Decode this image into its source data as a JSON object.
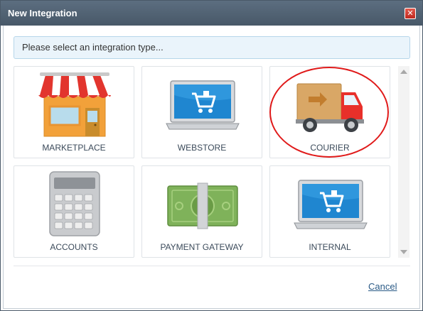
{
  "dialog": {
    "title": "New Integration",
    "close_icon": "close-icon",
    "hint": "Please select an integration type...",
    "cancel_label": "Cancel"
  },
  "tiles": [
    {
      "label": "MARKETPLACE",
      "icon": "storefront-icon"
    },
    {
      "label": "WEBSTORE",
      "icon": "laptop-cart-icon"
    },
    {
      "label": "COURIER",
      "icon": "delivery-truck-icon"
    },
    {
      "label": "ACCOUNTS",
      "icon": "calculator-icon"
    },
    {
      "label": "PAYMENT GATEWAY",
      "icon": "banknote-icon"
    },
    {
      "label": "INTERNAL",
      "icon": "laptop-cart-icon"
    }
  ],
  "colors": {
    "titlebar": "#4f6071",
    "hint_bg": "#eaf4fb",
    "highlight": "#e01a1a",
    "label": "#3b4a5a",
    "link": "#2a5a86"
  }
}
